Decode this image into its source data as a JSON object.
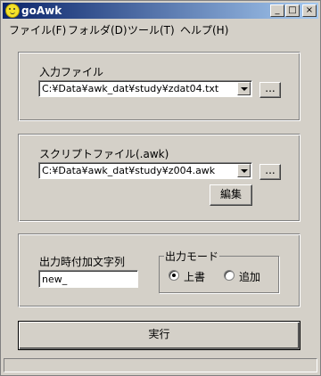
{
  "window": {
    "title": "goAwk"
  },
  "title_buttons": {
    "minimize": "_",
    "maximize": "□",
    "close": "×"
  },
  "menu": {
    "items": [
      {
        "label": "ファイル(F)"
      },
      {
        "label": "フォルダ(D)"
      },
      {
        "label": "ツール(T)"
      },
      {
        "label": "ヘルプ(H)"
      }
    ]
  },
  "input_file": {
    "label": "入力ファイル",
    "value": "C:¥Data¥awk_dat¥study¥zdat04.txt",
    "browse_label": "..."
  },
  "script_file": {
    "label": "スクリプトファイル(.awk)",
    "value": "C:¥Data¥awk_dat¥study¥z004.awk",
    "browse_label": "...",
    "edit_label": "編集"
  },
  "output": {
    "suffix_label": "出力時付加文字列",
    "suffix_value": "new_",
    "mode_label": "出力モード",
    "modes": [
      {
        "label": "上書",
        "selected": true
      },
      {
        "label": "追加",
        "selected": false
      }
    ]
  },
  "run_label": "実行",
  "status_text": ""
}
